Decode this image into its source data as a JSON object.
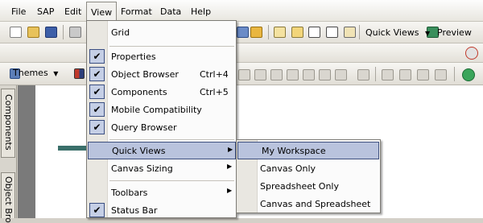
{
  "menubar": {
    "items": [
      {
        "label": "File"
      },
      {
        "label": "SAP"
      },
      {
        "label": "Edit"
      },
      {
        "label": "View"
      },
      {
        "label": "Format"
      },
      {
        "label": "Data"
      },
      {
        "label": "Help"
      }
    ]
  },
  "toolbar": {
    "quick_views_label": "Quick Views",
    "preview_label": "Preview",
    "themes_label": "Themes"
  },
  "side_tabs": {
    "components": "Components",
    "object_browser": "Object Bro"
  },
  "view_menu": {
    "grid": "Grid",
    "properties": "Properties",
    "object_browser": "Object Browser",
    "object_browser_shortcut": "Ctrl+4",
    "components": "Components",
    "components_shortcut": "Ctrl+5",
    "mobile_compatibility": "Mobile Compatibility",
    "query_browser": "Query Browser",
    "quick_views": "Quick Views",
    "canvas_sizing": "Canvas Sizing",
    "toolbars": "Toolbars",
    "status_bar": "Status Bar"
  },
  "quick_views_submenu": {
    "my_workspace": "My Workspace",
    "canvas_only": "Canvas Only",
    "spreadsheet_only": "Spreadsheet Only",
    "canvas_and_spreadsheet": "Canvas and Spreadsheet"
  },
  "colors": {
    "highlight": "#b9c3dd",
    "arrow": "#3a6f6a"
  }
}
